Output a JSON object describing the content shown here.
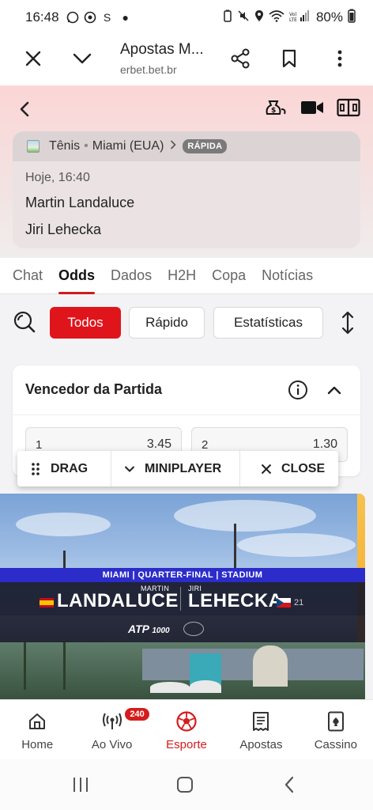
{
  "status_bar": {
    "time": "16:48",
    "extra_icon": "S",
    "battery": "80%"
  },
  "browser": {
    "title": "Apostas M...",
    "url": "erbet.bet.br"
  },
  "match": {
    "breadcrumb_sport": "Tênis",
    "breadcrumb_tournament": "Miami (EUA)",
    "badge": "RÁPIDA",
    "time": "Hoje, 16:40",
    "player1": "Martin Landaluce",
    "player2": "Jiri Lehecka"
  },
  "tabs": [
    "Chat",
    "Odds",
    "Dados",
    "H2H",
    "Copa",
    "Notícias"
  ],
  "filters": {
    "todos": "Todos",
    "rapido": "Rápido",
    "estatisticas": "Estatísticas"
  },
  "market": {
    "title": "Vencedor da Partida",
    "odds": [
      {
        "label": "1",
        "value": "3.45"
      },
      {
        "label": "2",
        "value": "1.30"
      }
    ]
  },
  "miniplayer": {
    "drag": "DRAG",
    "miniplayer": "MINIPLAYER",
    "close": "CLOSE"
  },
  "video": {
    "banner": "MIAMI | QUARTER-FINAL | STADIUM",
    "p1_first": "MARTIN",
    "p1_last": "LANDALUCE",
    "p2_first": "JIRI",
    "p2_last": "LEHECKA",
    "p2_seed": "21",
    "atp": "ATP",
    "atp_tier": "1000"
  },
  "bottom_nav": {
    "home": "Home",
    "live": "Ao Vivo",
    "live_count": "240",
    "sport": "Esporte",
    "bets": "Apostas",
    "casino": "Cassino"
  },
  "colors": {
    "accent": "#e0151b",
    "banner_blue": "#2b2cc9",
    "header_pink": "#fbd6d6"
  }
}
